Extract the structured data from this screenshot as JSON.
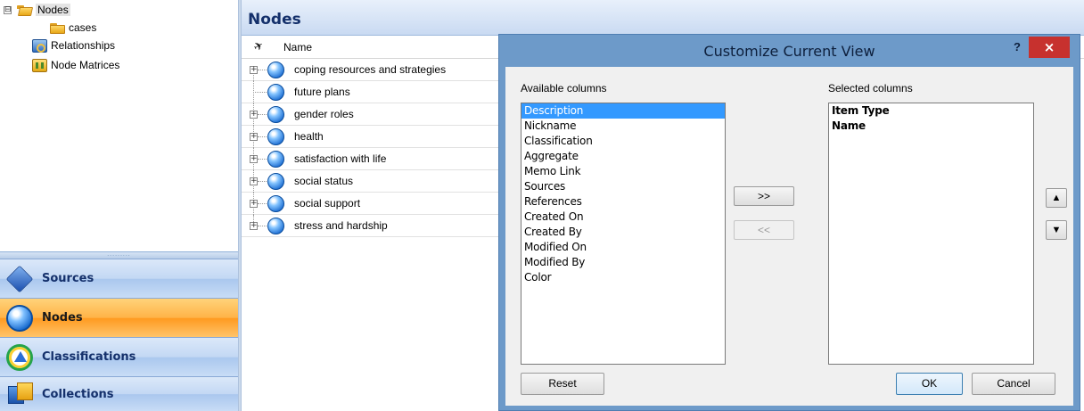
{
  "nav_tree": {
    "items": [
      {
        "label": "Nodes",
        "icon": "open-folder-icon",
        "expander": "⊟"
      },
      {
        "label": "cases",
        "icon": "folder-icon"
      },
      {
        "label": "Relationships",
        "icon": "relationships-icon"
      },
      {
        "label": "Node Matrices",
        "icon": "node-matrices-icon"
      }
    ]
  },
  "nav_buttons": [
    {
      "label": "Sources",
      "icon": "sources-icon",
      "active": false
    },
    {
      "label": "Nodes",
      "icon": "nodes-icon",
      "active": true
    },
    {
      "label": "Classifications",
      "icon": "classifications-icon",
      "active": false
    },
    {
      "label": "Collections",
      "icon": "collections-icon",
      "active": false
    }
  ],
  "nodes_panel": {
    "title": "Nodes",
    "column_name": "Name",
    "rows": [
      {
        "label": "coping resources and strategies",
        "expandable": true
      },
      {
        "label": "future plans",
        "expandable": false
      },
      {
        "label": "gender roles",
        "expandable": true
      },
      {
        "label": "health",
        "expandable": true
      },
      {
        "label": "satisfaction with life",
        "expandable": true
      },
      {
        "label": "social status",
        "expandable": true
      },
      {
        "label": "social support",
        "expandable": true
      },
      {
        "label": "stress and hardship",
        "expandable": true
      }
    ]
  },
  "dialog": {
    "title": "Customize Current View",
    "help_label": "?",
    "close_label": "×",
    "available_label": "Available columns",
    "selected_label": "Selected columns",
    "available_columns": [
      "Description",
      "Nickname",
      "Classification",
      "Aggregate",
      "Memo Link",
      "Sources",
      "References",
      "Created On",
      "Created By",
      "Modified On",
      "Modified By",
      "Color"
    ],
    "available_selected_index": 0,
    "selected_columns": [
      "Item Type",
      "Name"
    ],
    "add_label": ">>",
    "remove_label": "<<",
    "move_up_label": "▲",
    "move_down_label": "▼",
    "reset_label": "Reset",
    "ok_label": "OK",
    "cancel_label": "Cancel"
  },
  "colors": {
    "dialog_frame": "#6d9ac9",
    "close_button": "#c7312e",
    "selection": "#3399ff",
    "active_nav": "#ffb347"
  }
}
